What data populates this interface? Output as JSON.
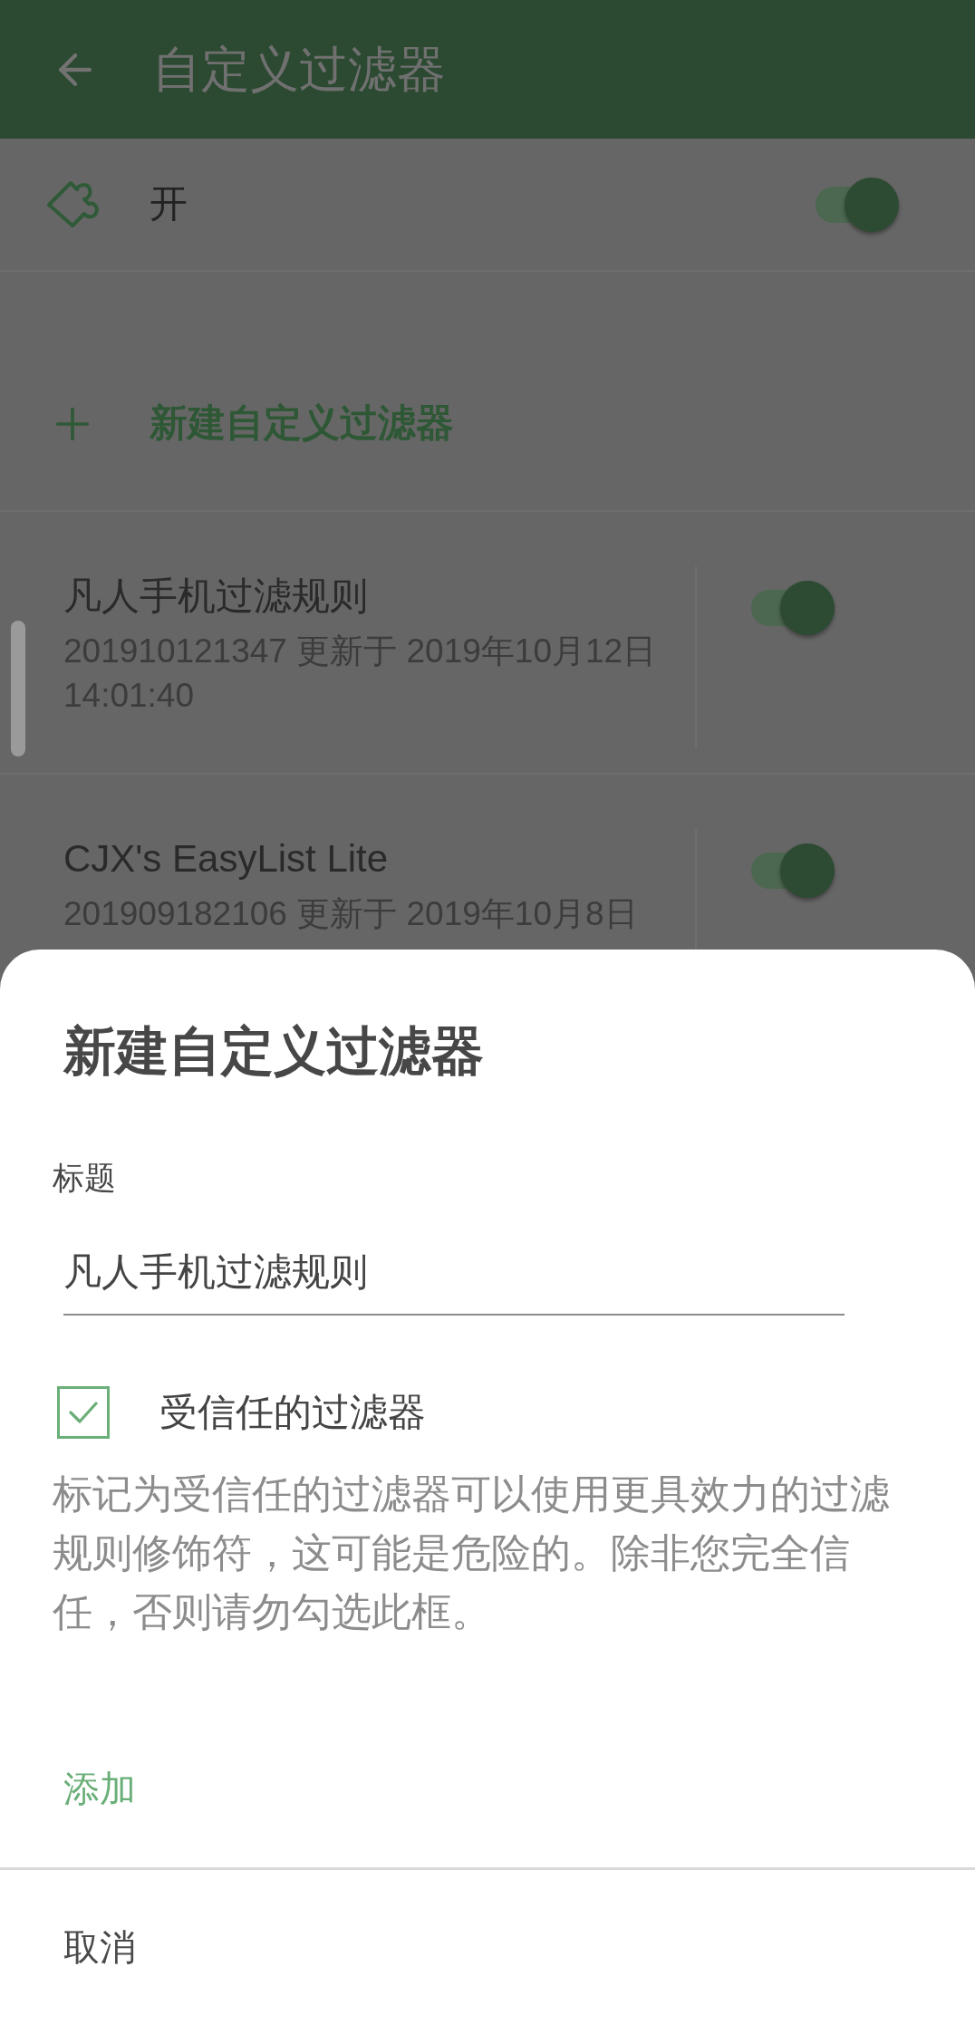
{
  "app_bar": {
    "title": "自定义过滤器"
  },
  "master_switch": {
    "label": "开",
    "on": true
  },
  "new_filter_action": {
    "label": "新建自定义过滤器"
  },
  "filters": [
    {
      "title": "凡人手机过滤规则",
      "subtitle": "201910121347 更新于 2019年10月12日 14:01:40",
      "enabled": true
    },
    {
      "title": "CJX's EasyList Lite",
      "subtitle": "201909182106 更新于 2019年10月8日",
      "enabled": true
    }
  ],
  "dialog": {
    "title": "新建自定义过滤器",
    "field": {
      "label": "标题",
      "value": "凡人手机过滤规则"
    },
    "trusted": {
      "label": "受信任的过滤器",
      "checked": true
    },
    "description": "标记为受信任的过滤器可以使用更具效力的过滤规则修饰符，这可能是危险的。除非您完全信任，否则请勿勾选此框。",
    "buttons": [
      {
        "label": "添加",
        "kind": "primary"
      },
      {
        "label": "取消",
        "kind": "secondary"
      }
    ]
  }
}
